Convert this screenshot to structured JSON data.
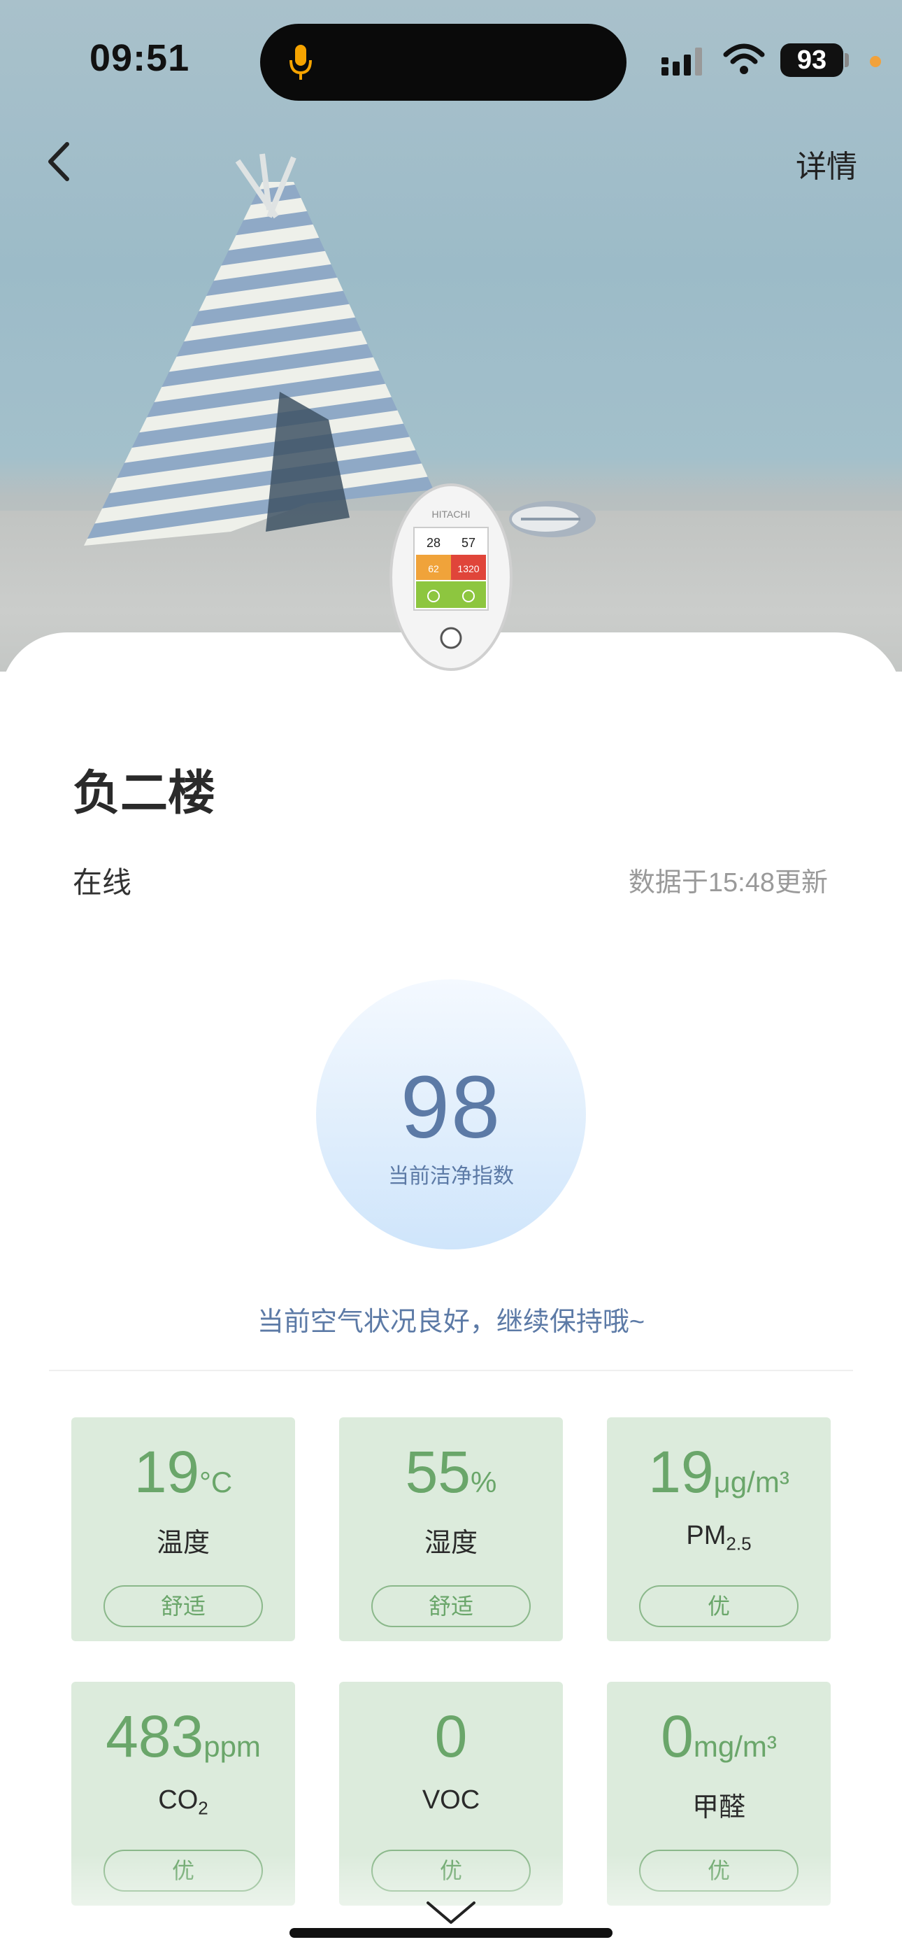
{
  "status_bar": {
    "time": "09:51",
    "battery": "93",
    "icons": [
      "mic-icon",
      "cellular-signal-icon",
      "wifi-icon",
      "battery-icon"
    ],
    "privacy_dot_color": "#f2a23b"
  },
  "nav": {
    "back_icon": "chevron-left-icon",
    "detail_label": "详情"
  },
  "device": {
    "brand": "HITACHI",
    "screen": {
      "temp": "28",
      "humidity": "57",
      "pm": "62",
      "co2": "1320"
    }
  },
  "room": {
    "name": "负二楼",
    "online_status": "在线",
    "update_time": "数据于15:48更新"
  },
  "score": {
    "value": "98",
    "label": "当前洁净指数"
  },
  "message": "当前空气状况良好，继续保持哦~",
  "metrics": [
    {
      "value": "19",
      "unit": "°C",
      "name": "温度",
      "name_sub": "",
      "status": "舒适"
    },
    {
      "value": "55",
      "unit": "%",
      "name": "湿度",
      "name_sub": "",
      "status": "舒适"
    },
    {
      "value": "19",
      "unit": "μg/m³",
      "name": "PM",
      "name_sub": "2.5",
      "status": "优"
    },
    {
      "value": "483",
      "unit": "ppm",
      "name": "CO",
      "name_sub": "2",
      "status": "优"
    },
    {
      "value": "0",
      "unit": "",
      "name": "VOC",
      "name_sub": "",
      "status": "优"
    },
    {
      "value": "0",
      "unit": "mg/m³",
      "name": "甲醛",
      "name_sub": "",
      "status": "优"
    }
  ],
  "colors": {
    "accent_blue": "#5c7aa6",
    "metric_green": "#6aa66a",
    "tile_bg": "#dcebdc"
  }
}
